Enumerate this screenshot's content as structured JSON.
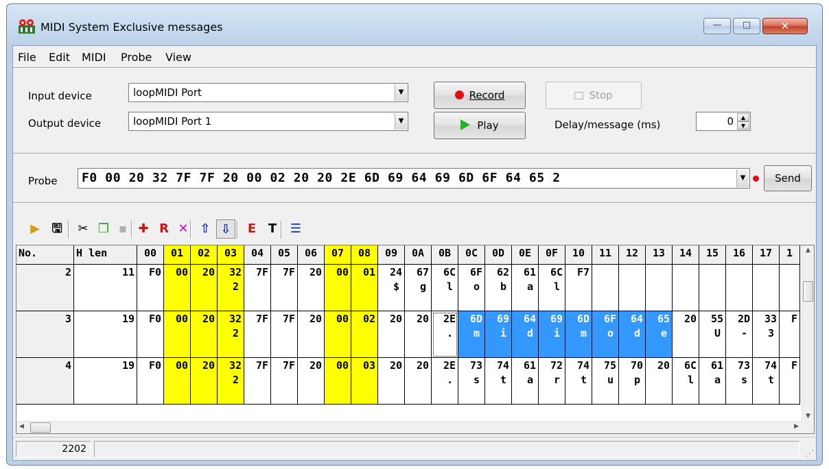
{
  "window": {
    "title": "MIDI System Exclusive messages",
    "controls": {
      "minimize": "—",
      "maximize": "□",
      "close": "✕"
    }
  },
  "menu": [
    "File",
    "Edit",
    "MIDI",
    "Probe",
    "View"
  ],
  "devices": {
    "input_label": "Input device",
    "input_value": "loopMIDI Port",
    "output_label": "Output device",
    "output_value": "loopMIDI Port 1",
    "record_label": "Record",
    "stop_label": "Stop",
    "play_label": "Play",
    "delay_label": "Delay/message (ms)",
    "delay_value": "0"
  },
  "probe": {
    "label": "Probe",
    "value": "F0 00 20 32 7F 7F 20 00 02 20 20 2E 6D 69 64 69 6D 6F 64 65 2",
    "send_label": "Send"
  },
  "toolbar": [
    {
      "name": "open-icon",
      "glyph": "▶",
      "color": "#d4a017"
    },
    {
      "name": "save-icon",
      "glyph": "🖫",
      "color": "#000000"
    },
    {
      "name": "cut-icon",
      "glyph": "✂",
      "color": "#000000"
    },
    {
      "name": "copy-icon",
      "glyph": "❐",
      "color": "#22a022"
    },
    {
      "name": "paste-icon",
      "glyph": "▪",
      "color": "#b0b0b0"
    },
    {
      "name": "add-icon",
      "glyph": "✚",
      "color": "#d01010"
    },
    {
      "name": "replace-icon",
      "glyph": "R",
      "color": "#d01010"
    },
    {
      "name": "delete-icon",
      "glyph": "✕",
      "color": "#c010c0"
    },
    {
      "name": "move-up-icon",
      "glyph": "⇧",
      "color": "#1030c0"
    },
    {
      "name": "move-down-icon",
      "glyph": "⇩",
      "color": "#1030c0"
    },
    {
      "name": "edit-icon",
      "glyph": "E",
      "color": "#c02010"
    },
    {
      "name": "text-icon",
      "glyph": "T",
      "color": "#000000"
    },
    {
      "name": "list-icon",
      "glyph": "☰",
      "color": "#1030c0"
    }
  ],
  "grid": {
    "columns": [
      "No.",
      "H len",
      "00",
      "01",
      "02",
      "03",
      "04",
      "05",
      "06",
      "07",
      "08",
      "09",
      "0A",
      "0B",
      "0C",
      "0D",
      "0E",
      "0F",
      "10",
      "11",
      "12",
      "13",
      "14",
      "15",
      "16",
      "17",
      "1"
    ],
    "highlight_columns": [
      "01",
      "02",
      "03",
      "07",
      "08"
    ],
    "rows": [
      {
        "no": "2",
        "hlen": "11",
        "hex": [
          "F0",
          "00",
          "20",
          "32",
          "7F",
          "7F",
          "20",
          "00",
          "01",
          "24",
          "67",
          "6C",
          "6F",
          "62",
          "61",
          "6C",
          "F7",
          "",
          "",
          "",
          "",
          "",
          "",
          "",
          "",
          ""
        ],
        "ascii": [
          "",
          "",
          "",
          "2",
          "",
          "",
          "",
          "",
          "",
          "$",
          "g",
          "l",
          "o",
          "b",
          "a",
          "l",
          "",
          "",
          "",
          "",
          "",
          "",
          "",
          "",
          "",
          ""
        ]
      },
      {
        "no": "3",
        "hlen": "19",
        "hex": [
          "F0",
          "00",
          "20",
          "32",
          "7F",
          "7F",
          "20",
          "00",
          "02",
          "20",
          "20",
          "2E",
          "6D",
          "69",
          "64",
          "69",
          "6D",
          "6F",
          "64",
          "65",
          "20",
          "55",
          "2D",
          "33",
          "F"
        ],
        "ascii": [
          "",
          "",
          "",
          "2",
          "",
          "",
          "",
          "",
          "",
          "",
          "",
          ".",
          "m",
          "i",
          "d",
          "i",
          "m",
          "o",
          "d",
          "e",
          "",
          "U",
          "-",
          "3",
          ""
        ]
      },
      {
        "no": "4",
        "hlen": "19",
        "hex": [
          "F0",
          "00",
          "20",
          "32",
          "7F",
          "7F",
          "20",
          "00",
          "03",
          "20",
          "20",
          "2E",
          "73",
          "74",
          "61",
          "72",
          "74",
          "75",
          "70",
          "20",
          "6C",
          "61",
          "73",
          "74",
          "F"
        ],
        "ascii": [
          "",
          "",
          "",
          "2",
          "",
          "",
          "",
          "",
          "",
          "",
          "",
          ".",
          "s",
          "t",
          "a",
          "r",
          "t",
          "u",
          "p",
          "",
          "l",
          "a",
          "s",
          "t",
          ""
        ]
      }
    ]
  },
  "status": {
    "count": "2202"
  }
}
